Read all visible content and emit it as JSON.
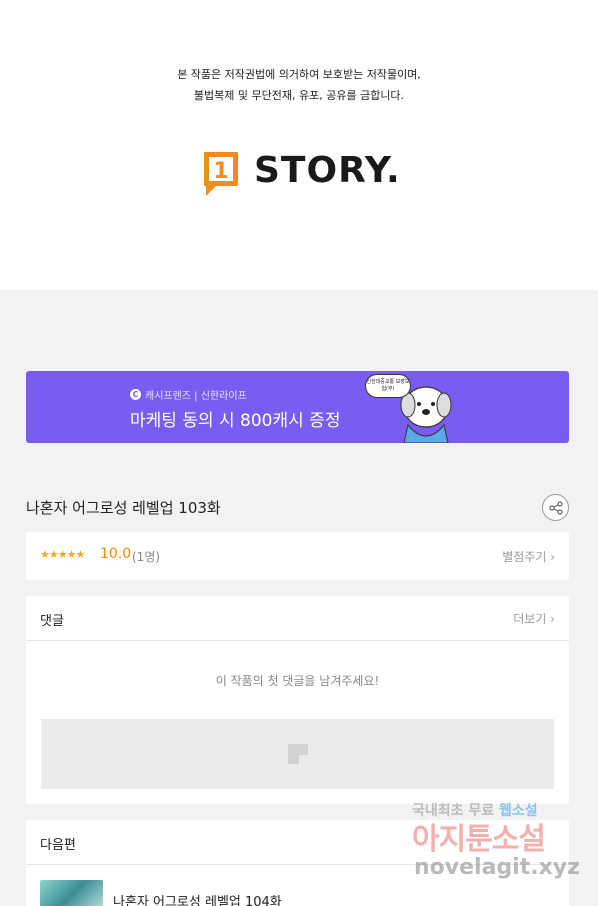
{
  "copyright": {
    "line1": "본 작품은 저작권법에 의거하여 보호받는 저작물이며,",
    "line2": "불법복제 및 무단전재, 유포, 공유를 금합니다."
  },
  "logo": {
    "badge_number": "1",
    "text": "STORY.",
    "brand_color": "#f28c1c"
  },
  "banner": {
    "icon_letter": "C",
    "sub": "캐시프렌즈 | 신한라이프",
    "title": "마케팅 동의 시 800캐시 증정",
    "bubble_text": "신한대중교통 보장보험(무)",
    "color": "#7a5cf0"
  },
  "episode": {
    "title": "나혼자 어그로성 레벨업 103화",
    "share_icon": "share-icon"
  },
  "rating": {
    "stars": "★★★★★",
    "score": "10.0",
    "count": "(1명)",
    "rate_link": "별점주기 ›"
  },
  "comments": {
    "label": "댓글",
    "more": "더보기 ›",
    "empty_message": "이 작품의 첫 댓글을 남겨주세요!"
  },
  "next": {
    "label": "다음편",
    "item_title": "나혼자 어그로성 레벨업 104화"
  },
  "watermark": {
    "line1_a": "국내최초 무료 ",
    "line1_b": "웹소설",
    "line2": "아지툰소설",
    "line3": "novelagit.xyz"
  }
}
